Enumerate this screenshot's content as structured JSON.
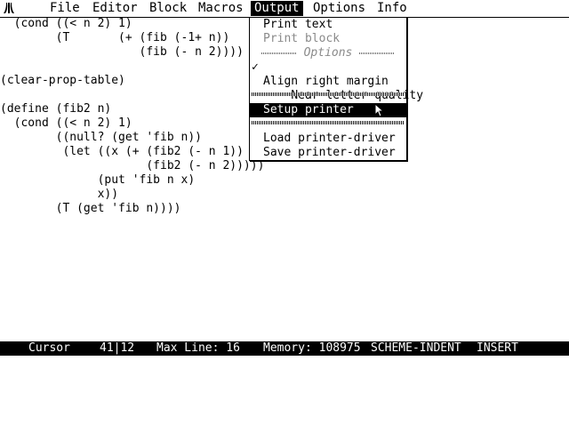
{
  "menubar": {
    "logo_icon": "atari-fuji-icon",
    "items": [
      "File",
      "Editor",
      "Block",
      "Macros",
      "Output",
      "Options",
      "Info"
    ],
    "active": "Output"
  },
  "editor": {
    "lines": [
      "  (cond ((< n 2) 1)",
      "        (T       (+ (fib (-1+ n))",
      "                    (fib (- n 2))))",
      "",
      "(clear-prop-table)",
      "",
      "(define (fib2 n)",
      "  (cond ((< n 2) 1)",
      "        ((null? (get 'fib n))",
      "         (let ((x (+ (fib2 (- n 1))",
      "                     (fib2 (- n 2)))))",
      "              (put 'fib n x)",
      "              x))",
      "        (T (get 'fib n))))"
    ]
  },
  "dropdown": {
    "print_text": "Print text",
    "print_block": "Print block",
    "options_label": "Options",
    "check_mark": "✓",
    "near_letter_quality": "Near letter quality",
    "align_right_margin": "Align right margin",
    "setup_printer": "Setup printer",
    "load_printer_driver": "Load printer-driver",
    "save_printer_driver": "Save printer-driver"
  },
  "statusbar": {
    "cursor_label": "Cursor",
    "cursor_pos": "41|12",
    "max_line": "Max Line: 16",
    "memory": "Memory: 108975",
    "mode": "SCHEME-INDENT",
    "insert": "INSERT"
  },
  "colors": {
    "foreground": "#000000",
    "background": "#ffffff",
    "disabled": "#8a8a8a"
  }
}
